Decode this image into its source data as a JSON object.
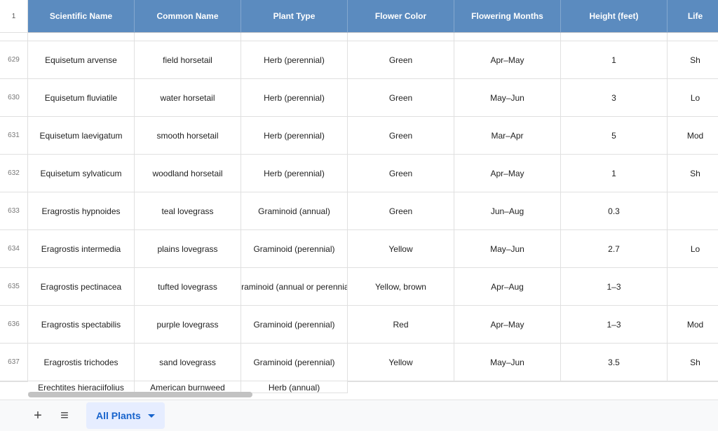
{
  "corner_label": "1",
  "columns": [
    "Scientific Name",
    "Common Name",
    "Plant Type",
    "Flower Color",
    "Flowering Months",
    "Height (feet)",
    "Life"
  ],
  "preview_row": {
    "rownum": "",
    "cells": [
      "",
      "",
      "",
      "",
      "",
      "",
      ""
    ]
  },
  "rows": [
    {
      "rownum": "629",
      "cells": [
        "Equisetum arvense",
        "field horsetail",
        "Herb (perennial)",
        "Green",
        "Apr–May",
        "1",
        "Sh"
      ]
    },
    {
      "rownum": "630",
      "cells": [
        "Equisetum fluviatile",
        "water horsetail",
        "Herb (perennial)",
        "Green",
        "May–Jun",
        "3",
        "Lo"
      ]
    },
    {
      "rownum": "631",
      "cells": [
        "Equisetum laevigatum",
        "smooth horsetail",
        "Herb (perennial)",
        "Green",
        "Mar–Apr",
        "5",
        "Mod"
      ]
    },
    {
      "rownum": "632",
      "cells": [
        "Equisetum sylvaticum",
        "woodland horsetail",
        "Herb (perennial)",
        "Green",
        "Apr–May",
        "1",
        "Sh"
      ]
    },
    {
      "rownum": "633",
      "cells": [
        "Eragrostis hypnoides",
        "teal lovegrass",
        "Graminoid (annual)",
        "Green",
        "Jun–Aug",
        "0.3",
        ""
      ]
    },
    {
      "rownum": "634",
      "cells": [
        "Eragrostis intermedia",
        "plains lovegrass",
        "Graminoid (perennial)",
        "Yellow",
        "May–Jun",
        "2.7",
        "Lo"
      ]
    },
    {
      "rownum": "635",
      "cells": [
        "Eragrostis pectinacea",
        "tufted lovegrass",
        "Graminoid (annual or perennial)",
        "Yellow, brown",
        "Apr–Aug",
        "1–3",
        ""
      ]
    },
    {
      "rownum": "636",
      "cells": [
        "Eragrostis spectabilis",
        "purple lovegrass",
        "Graminoid (perennial)",
        "Red",
        "Apr–May",
        "1–3",
        "Mod"
      ]
    },
    {
      "rownum": "637",
      "cells": [
        "Eragrostis trichodes",
        "sand lovegrass",
        "Graminoid (perennial)",
        "Yellow",
        "May–Jun",
        "3.5",
        "Sh"
      ]
    }
  ],
  "cut_row": {
    "rownum": "",
    "cells": [
      "Erechtites hieraciifolius",
      "American burnweed",
      "Herb (annual)",
      "",
      "",
      "",
      ""
    ]
  },
  "bottom_bar": {
    "add_sheet_label": "+",
    "all_sheets_label": "≡",
    "active_tab": "All Plants"
  },
  "chart_data": {
    "type": "table",
    "columns": [
      "Scientific Name",
      "Common Name",
      "Plant Type",
      "Flower Color",
      "Flowering Months",
      "Height (feet)",
      "Life"
    ],
    "rows": [
      [
        "Equisetum arvense",
        "field horsetail",
        "Herb (perennial)",
        "Green",
        "Apr–May",
        "1",
        "Sh"
      ],
      [
        "Equisetum fluviatile",
        "water horsetail",
        "Herb (perennial)",
        "Green",
        "May–Jun",
        "3",
        "Lo"
      ],
      [
        "Equisetum laevigatum",
        "smooth horsetail",
        "Herb (perennial)",
        "Green",
        "Mar–Apr",
        "5",
        "Mod"
      ],
      [
        "Equisetum sylvaticum",
        "woodland horsetail",
        "Herb (perennial)",
        "Green",
        "Apr–May",
        "1",
        "Sh"
      ],
      [
        "Eragrostis hypnoides",
        "teal lovegrass",
        "Graminoid (annual)",
        "Green",
        "Jun–Aug",
        "0.3",
        ""
      ],
      [
        "Eragrostis intermedia",
        "plains lovegrass",
        "Graminoid (perennial)",
        "Yellow",
        "May–Jun",
        "2.7",
        "Lo"
      ],
      [
        "Eragrostis pectinacea",
        "tufted lovegrass",
        "Graminoid (annual or perennial)",
        "Yellow, brown",
        "Apr–Aug",
        "1–3",
        ""
      ],
      [
        "Eragrostis spectabilis",
        "purple lovegrass",
        "Graminoid (perennial)",
        "Red",
        "Apr–May",
        "1–3",
        "Mod"
      ],
      [
        "Eragrostis trichodes",
        "sand lovegrass",
        "Graminoid (perennial)",
        "Yellow",
        "May–Jun",
        "3.5",
        "Sh"
      ],
      [
        "Erechtites hieraciifolius",
        "American burnweed",
        "Herb (annual)",
        "",
        "",
        "",
        ""
      ]
    ]
  }
}
